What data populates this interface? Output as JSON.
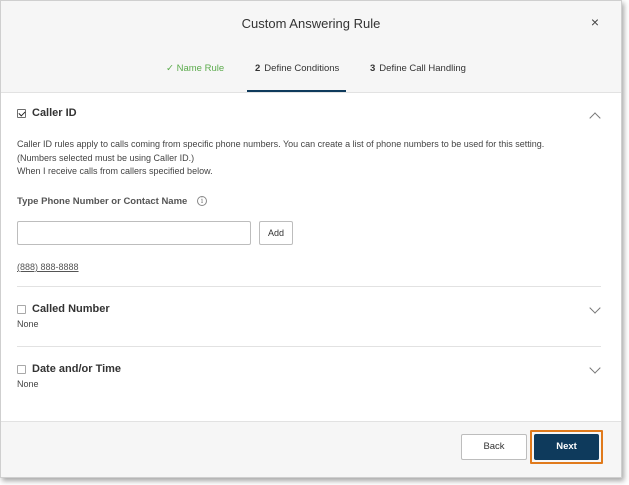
{
  "dialog": {
    "title": "Custom Answering Rule",
    "close_glyph": "×"
  },
  "steps": [
    {
      "number": "✓",
      "label": "Name Rule",
      "state": "done"
    },
    {
      "number": "2",
      "label": "Define Conditions",
      "state": "active"
    },
    {
      "number": "3",
      "label": "Define Call Handling",
      "state": "todo"
    }
  ],
  "caller_id": {
    "title": "Caller ID",
    "checked": true,
    "expanded": true,
    "description_line1": "Caller ID rules apply to calls coming from specific phone numbers. You can create a list of phone numbers to be used for this setting.",
    "description_line2": "(Numbers selected must be using Caller ID.)",
    "description_line3": "When I receive calls from callers specified below.",
    "field_label": "Type Phone Number or Contact Name",
    "info_icon": "i",
    "input_value": "",
    "input_placeholder": "",
    "add_label": "Add",
    "numbers": [
      "(888) 888-8888"
    ]
  },
  "called_number": {
    "title": "Called Number",
    "checked": false,
    "value": "None"
  },
  "date_time": {
    "title": "Date and/or Time",
    "checked": false,
    "value": "None"
  },
  "footer": {
    "back_label": "Back",
    "next_label": "Next"
  },
  "colors": {
    "primary": "#0e3a5c",
    "highlight": "#e07a1c",
    "success": "#5cab4d"
  }
}
